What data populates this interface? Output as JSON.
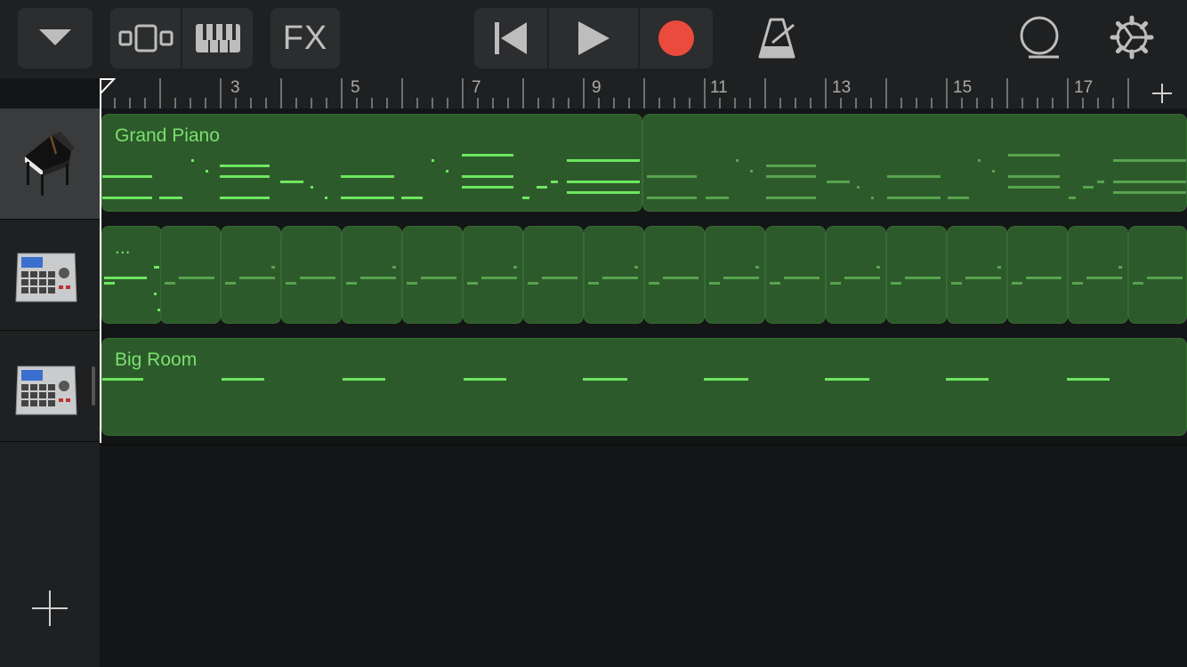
{
  "toolbar": {
    "fx_label": "FX",
    "accent_record": "#ea4b3c",
    "buttons": [
      "track-menu",
      "tracks-view",
      "keyboard",
      "fx",
      "rewind",
      "play",
      "record",
      "metronome",
      "loops",
      "settings"
    ]
  },
  "ruler": {
    "bar_numbers": [
      "3",
      "5",
      "7",
      "9",
      "11",
      "13",
      "15",
      "17"
    ]
  },
  "tracks": [
    {
      "name": "Grand Piano",
      "icon": "grand-piano-icon",
      "region_title": "Grand Piano"
    },
    {
      "name": "Drum Machine",
      "icon": "drum-machine-icon",
      "region_title": "..."
    },
    {
      "name": "Big Room",
      "icon": "drum-machine-icon",
      "region_title": "Big Room"
    }
  ],
  "colors": {
    "region": "#2d5a2b",
    "note": "#6ee660",
    "background": "#141516"
  }
}
